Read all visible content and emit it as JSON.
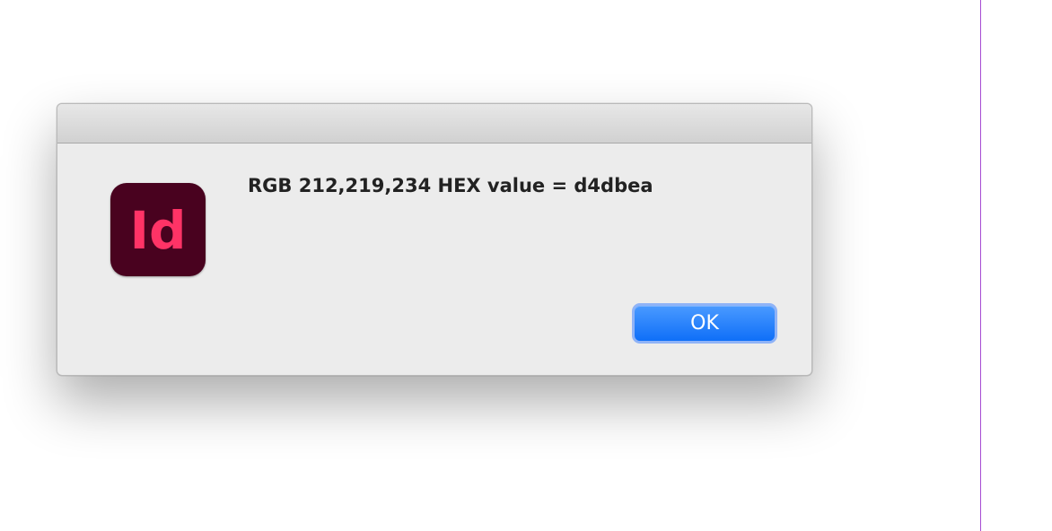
{
  "dialog": {
    "icon": "indesign-app-icon",
    "icon_text": "Id",
    "message": "RGB 212,219,234 HEX value = d4dbea",
    "ok_label": "OK"
  },
  "colors": {
    "icon_background": "#49021f",
    "icon_text": "#ff3366",
    "button_blue": "#0f6ff8",
    "page_guide": "#a64cd3"
  }
}
